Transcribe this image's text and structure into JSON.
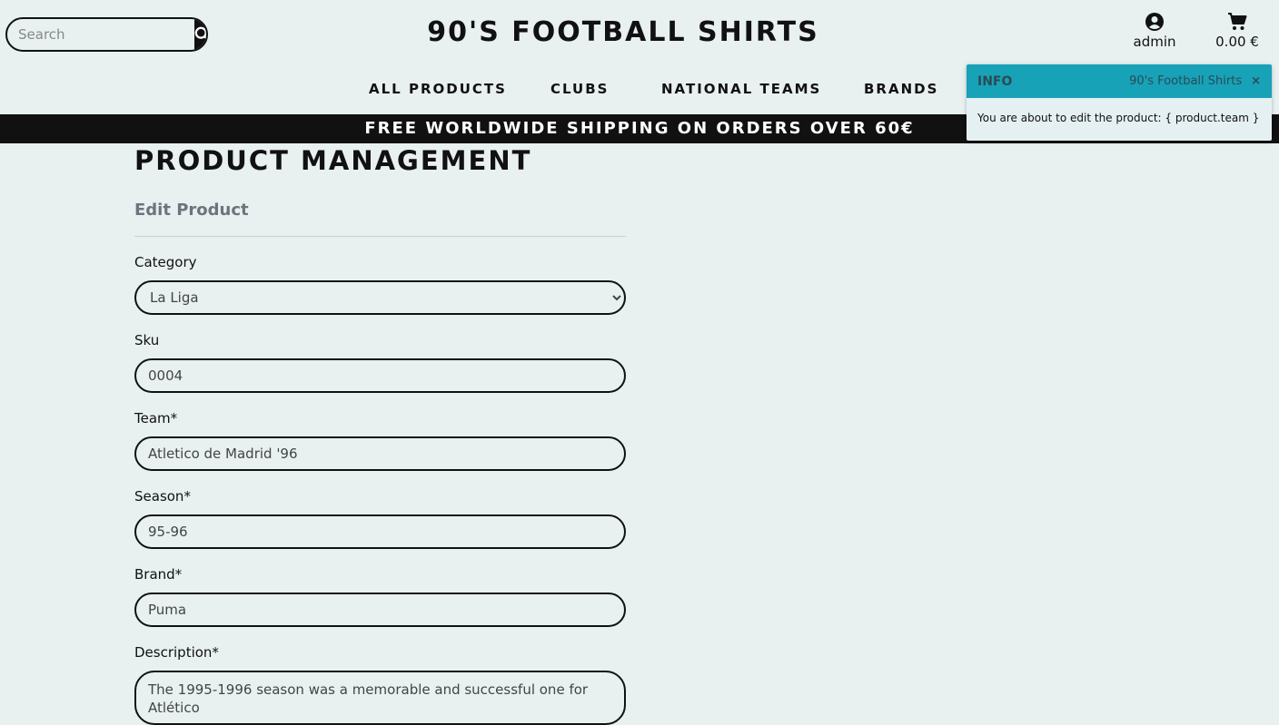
{
  "header": {
    "search_placeholder": "Search",
    "brand": "90'S FOOTBALL SHIRTS",
    "account_label": "admin",
    "cart_total": "0.00 €"
  },
  "nav": {
    "items": [
      "ALL PRODUCTS",
      "CLUBS",
      "NATIONAL TEAMS",
      "BRANDS"
    ]
  },
  "banner": "FREE WORLDWIDE SHIPPING ON ORDERS OVER 60€",
  "toast": {
    "title": "INFO",
    "source": "90's Football Shirts",
    "close": "×",
    "message": "You are about to edit the product: { product.team }"
  },
  "page": {
    "title": "PRODUCT MANAGEMENT",
    "subtitle": "Edit Product"
  },
  "form": {
    "category": {
      "label": "Category",
      "value": "La Liga"
    },
    "sku": {
      "label": "Sku",
      "value": "0004"
    },
    "team": {
      "label": "Team*",
      "value": "Atletico de Madrid '96"
    },
    "season": {
      "label": "Season*",
      "value": "95-96"
    },
    "brand": {
      "label": "Brand*",
      "value": "Puma"
    },
    "description": {
      "label": "Description*",
      "value": "The 1995-1996 season was a memorable and successful one for Atlético"
    }
  },
  "colors": {
    "accent": "#17a2b8",
    "dark": "#111111",
    "background": "#e8f0f0"
  }
}
